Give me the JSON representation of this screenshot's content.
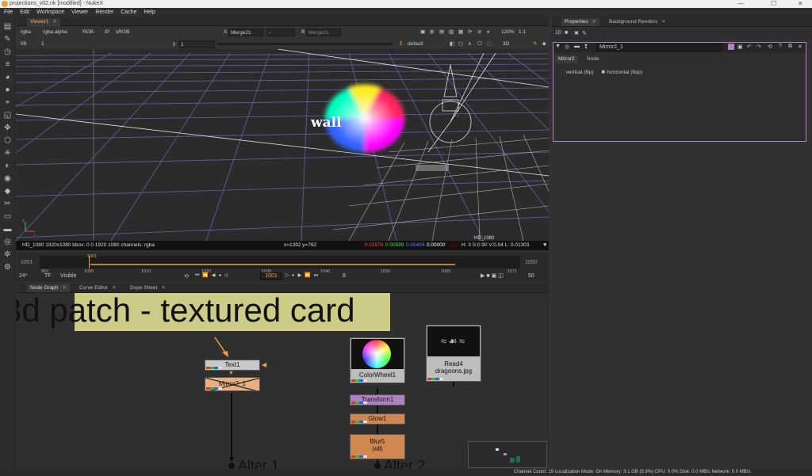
{
  "titlebar": {
    "title": "projections_v02.nk [modified] - NukeX",
    "min": "—",
    "max": "☐",
    "close": "✕"
  },
  "menubar": {
    "items": [
      "File",
      "Edit",
      "Workspace",
      "Viewer",
      "Render",
      "Cache",
      "Help"
    ]
  },
  "viewer": {
    "tab": "Viewer1",
    "channels": "rgba",
    "alpha": "rgba.alpha",
    "rgb": "RGB",
    "ip": "IP",
    "colorspace": "sRGB",
    "a_label": "A",
    "a_input": "Merge21",
    "a_op": "-",
    "b_label": "B",
    "b_input": "Merge21",
    "zoom": "120%",
    "ratio": "1:1",
    "fstop": "f/8",
    "frame_step": "1",
    "y_label": "y",
    "y_value": "1",
    "lut": "default",
    "view_mode": "3D",
    "scene_text": "wall",
    "format_label": "HD_1080",
    "status_left": "HD_1080 1920x1080  bbox: 0 0 1920 1080 channels: rgba",
    "status_coord": "x=1392 y=762",
    "status_r": "0.03976",
    "status_g": "0.00599",
    "status_b": "0.00404",
    "status_a": "0.00000",
    "status_hsv": "H:  3 S:0.90 V:0.04  L: 0.01303"
  },
  "timeline": {
    "start": "1001",
    "end": "1050",
    "ticks": [
      "992",
      "1000",
      "1010",
      "1020",
      "1030",
      "1040",
      "1050",
      "1060",
      "1071"
    ],
    "current_marker": "1001",
    "fps": "24*",
    "tf": "TF",
    "visible": "Visible",
    "frame": "1001",
    "step": "10",
    "inc": "8",
    "end_frame": "50"
  },
  "nodegraph": {
    "tabs": [
      "Node Graph",
      "Curve Editor",
      "Dope Sheet"
    ],
    "backdrop_label": "3d patch - textured card",
    "nodes": {
      "text1": "Text1",
      "mirror": "Mirror2_1",
      "colorwheel": "ColorWheel1",
      "read4": "Read4",
      "read4_file": "dragoons.jpg",
      "transform": "Transform1",
      "glow": "Glow1",
      "blur": "Blur5",
      "blur_sub": "(all)",
      "alter1": "Alter 1",
      "alter2": "Alter 2"
    }
  },
  "properties": {
    "tabs": [
      "Properties",
      "Background Renders"
    ],
    "node_name": "Mirror2_1",
    "subtabs": [
      "Mirror2",
      "Node"
    ],
    "vertical_label": "vertical (flip)",
    "horizontal_label": "horizontal (flop)",
    "vertical_checked": false,
    "horizontal_checked": true
  },
  "statusbar": {
    "text": "Channel Count: 19  Localization Mode: On  Memory: 3.1 GB (9.9%)  CPU: 0.0%  Disk: 0.0 MB/s  Network: 0.0 MB/s"
  },
  "colors": {
    "accent": "#f0a040",
    "backdrop": "#cccc88",
    "props_border": "#b080c0",
    "grid_line": "#7070c0"
  }
}
